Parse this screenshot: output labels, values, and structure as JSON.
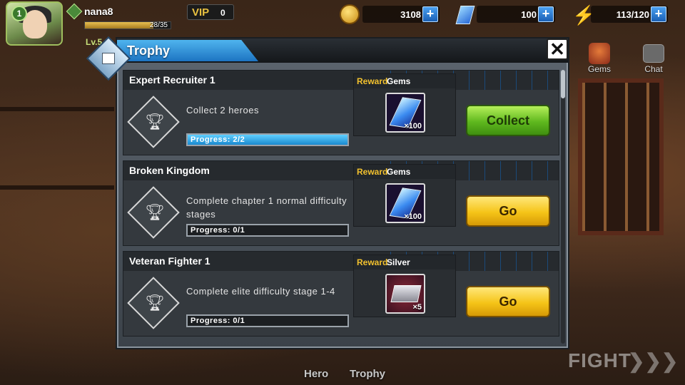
{
  "player": {
    "name": "nana8",
    "level": "1",
    "exp": "28/35",
    "exp_progress": 0.8,
    "side_level": "Lv.5"
  },
  "vip": {
    "label": "VIP",
    "value": "0"
  },
  "resources": {
    "gold": "3108",
    "gems": "100",
    "stamina": "113/120"
  },
  "side_menu": {
    "gems": "Gems",
    "chat": "Chat"
  },
  "modal": {
    "title": "Trophy"
  },
  "trophies": [
    {
      "title": "Expert Recruiter 1",
      "desc": "Collect 2 heroes",
      "progress": "Progress: 2/2",
      "progress_value": 1.0,
      "reward_label": "Reward",
      "reward_name": "Gems",
      "reward_qty": "×100",
      "action": "Collect"
    },
    {
      "title": "Broken Kingdom",
      "desc": "Complete chapter 1 normal difficulty stages",
      "progress": "Progress: 0/1",
      "progress_value": 0,
      "reward_label": "Reward",
      "reward_name": "Gems",
      "reward_qty": "×100",
      "action": "Go"
    },
    {
      "title": "Veteran Fighter 1",
      "desc": "Complete elite difficulty stage 1-4",
      "progress": "Progress: 0/1",
      "progress_value": 0,
      "reward_label": "Reward",
      "reward_name": "Silver",
      "reward_qty": "×5",
      "action": "Go"
    }
  ],
  "bottom_tabs": {
    "hero": "Hero",
    "trophy": "Trophy"
  },
  "fight": {
    "label": "FIGHT",
    "arrows": "❯❯❯"
  },
  "icons": {
    "close": "close-icon",
    "trophy": "trophy-icon",
    "gem": "gem-icon",
    "silver": "silver-ingot-icon",
    "gold": "gold-coin-icon",
    "stamina": "lightning-icon"
  },
  "colors": {
    "title_tab": "#2e8fd8",
    "collect_btn": "#6cc424",
    "go_btn": "#f5c418",
    "reward_label": "#f2c12e"
  }
}
